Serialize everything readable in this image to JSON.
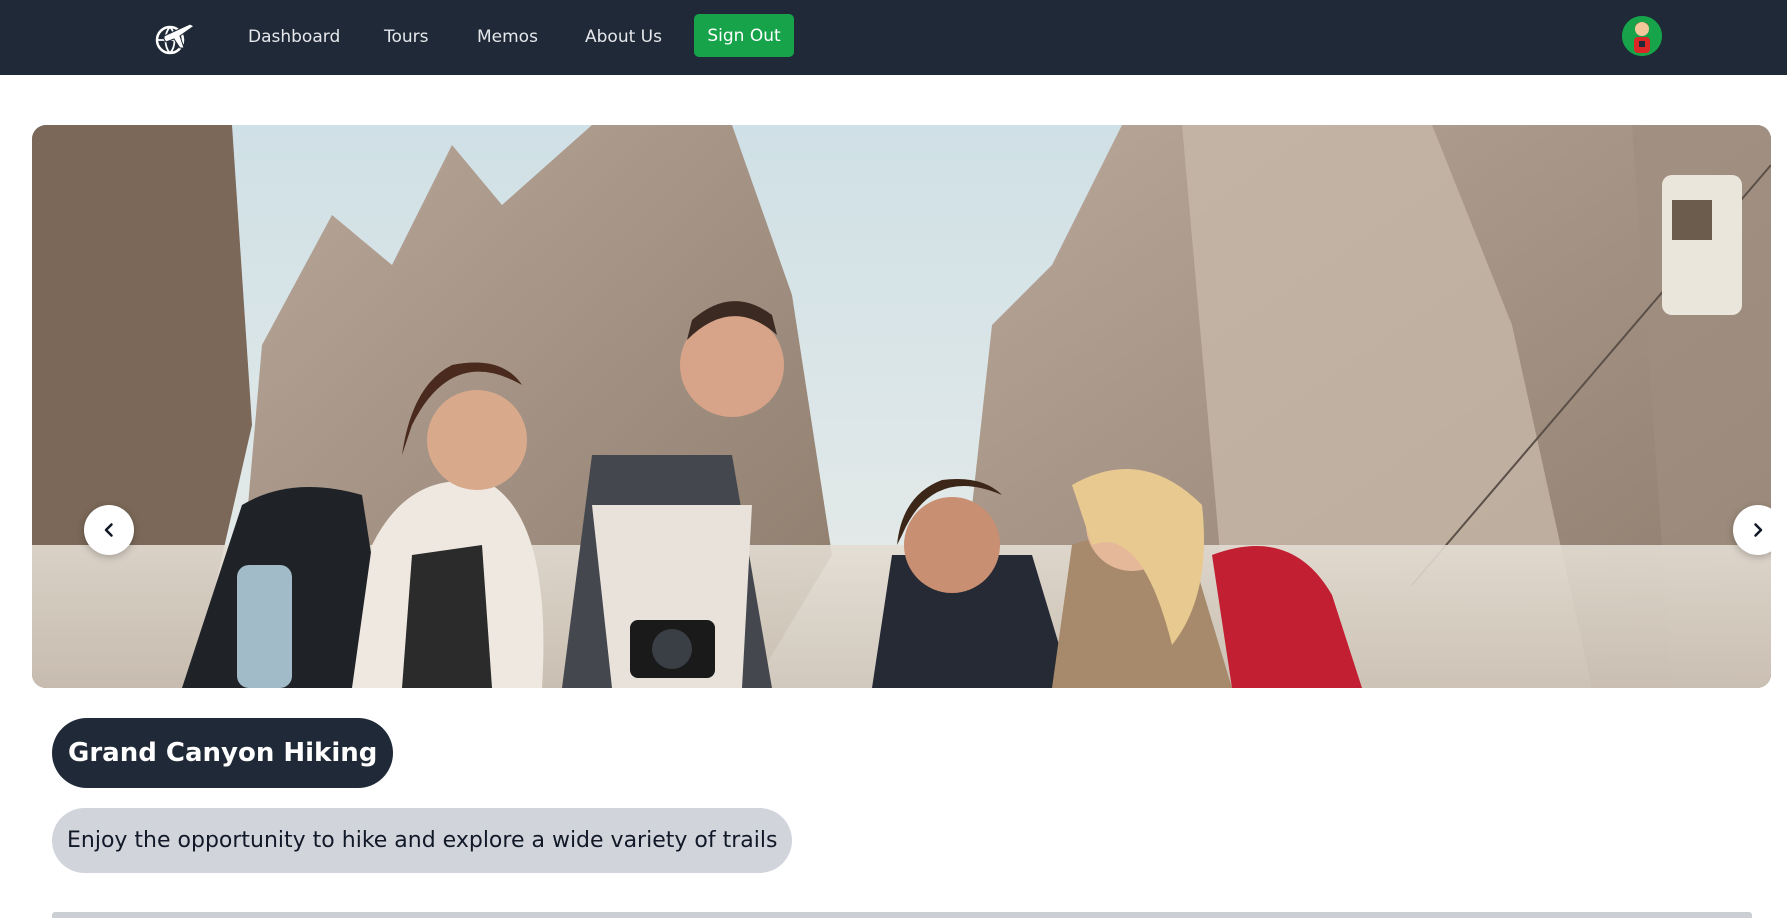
{
  "nav": {
    "logo_icon": "airplane-globe-icon",
    "links": [
      "Dashboard",
      "Tours",
      "Memos",
      "About Us"
    ],
    "signout_label": "Sign Out",
    "avatar_icon": "user-avatar-icon"
  },
  "carousel": {
    "prev_icon": "chevron-left-icon",
    "next_icon": "chevron-right-icon",
    "image_alt": "photo"
  },
  "tour": {
    "title": "Grand Canyon Hiking",
    "subtitle": "Enjoy the opportunity to hike and explore a wide variety of trails"
  },
  "colors": {
    "navbar_bg": "#1f2937",
    "signout_bg": "#16a34a",
    "title_bg": "#1f2937",
    "subtitle_bg": "#d1d5db"
  }
}
